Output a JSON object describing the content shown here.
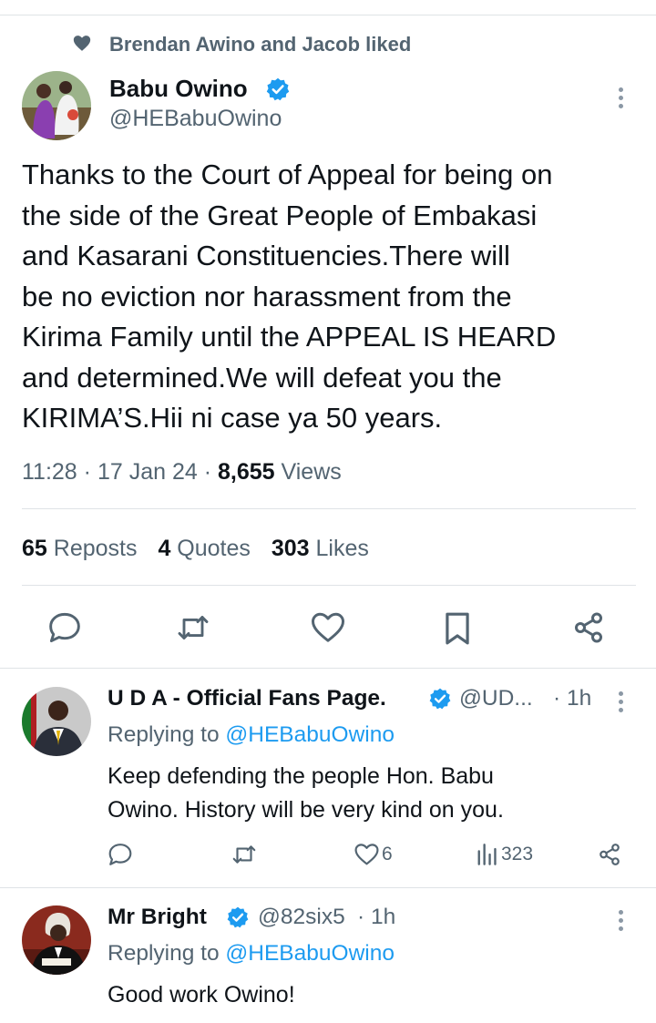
{
  "social_context": {
    "text": "Brendan Awino and Jacob liked"
  },
  "main_tweet": {
    "author_name": "Babu Owino",
    "handle": "@HEBabuOwino",
    "lines": [
      "Thanks to the Court of Appeal for being on",
      "the side of the Great People of Embakasi",
      "and Kasarani Constituencies.There will",
      "be no eviction nor harassment from the",
      "Kirima Family until the APPEAL IS HEARD",
      "and determined.We will defeat you the",
      "KIRIMA’S.Hii ni case ya 50 years."
    ],
    "time": "11:28",
    "sep": "·",
    "date": "17 Jan 24",
    "views_count": "8,655",
    "views_label": "Views",
    "reposts_count": "65",
    "reposts_label": "Reposts",
    "quotes_count": "4",
    "quotes_label": "Quotes",
    "likes_count": "303",
    "likes_label": "Likes"
  },
  "replies": [
    {
      "author_name": "U D A - Official Fans Page.",
      "handle": "@UD...",
      "time": "· 1h",
      "replying_prefix": "Replying to",
      "replying_handle": "@HEBabuOwino",
      "lines": [
        "Keep defending the people Hon. Babu",
        "Owino. History will be very kind on you."
      ],
      "like_count": "6",
      "view_count": "323"
    },
    {
      "author_name": "Mr Bright",
      "handle": "@82six5",
      "time": "· 1h",
      "replying_prefix": "Replying to",
      "replying_handle": "@HEBabuOwino",
      "lines": [
        "Good work Owino!"
      ]
    }
  ],
  "colors": {
    "accent": "#1d9bf0",
    "secondary_text": "#536471",
    "divider": "#dfe3e6"
  },
  "icons": [
    "heart-icon",
    "verified-badge-icon",
    "more-icon",
    "reply-icon",
    "repost-icon",
    "like-icon",
    "bookmark-icon",
    "share-icon",
    "views-icon"
  ]
}
